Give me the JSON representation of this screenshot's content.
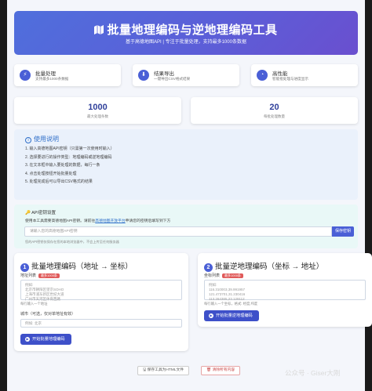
{
  "header": {
    "title": "批量地理编码与逆地理编码工具",
    "subtitle": "基于高德地图API | 专注于批量处理，支持最多1000条数据"
  },
  "features": [
    {
      "icon": "bolt-icon",
      "title": "批量处理",
      "desc": "支持最多1000条数据"
    },
    {
      "icon": "download-icon",
      "title": "结果导出",
      "desc": "一键导出CSV格式结果"
    },
    {
      "icon": "gauge-icon",
      "title": "高性能",
      "desc": "智能批处理与进度显示"
    }
  ],
  "stats": [
    {
      "value": "1000",
      "label": "最大处理条数"
    },
    {
      "value": "20",
      "label": "每批处理数量"
    }
  ],
  "usage": {
    "title": "使用说明",
    "steps": [
      "1. 输入高德地图API密钥（只需第一次使用时输入）",
      "2. 选择要进行的操作类型：地理编码或逆地理编码",
      "3. 在文本框中输入要处理的数据，每行一条",
      "4. 点击处理按钮开始批量处理",
      "5. 处理完成后可以导出CSV格式的结果"
    ]
  },
  "api": {
    "title": "API密钥设置",
    "desc_prefix": "使用本工具需要高德地图API密钥。请前往",
    "link": "高德地图开放平台",
    "desc_suffix": "申请您的密钥后填写到下方",
    "placeholder": "请输入您的高德地图API密钥",
    "save_label": "保存密钥",
    "note": "您的API密钥仅保存在您的本地浏览器中，不会上传至任何服务器"
  },
  "geocode": {
    "title": "批量地理编码（地址 → 坐标）",
    "list_label": "地址列表",
    "badge": "最多1000条",
    "placeholder": "例如:\n北京市朝阳区望京SOHO\n上海市浦东新区世纪大道\n广州市天河区体育西路",
    "hint": "每行输入一个地址",
    "city_label": "城市（可选，仅对单地址有效）",
    "city_placeholder": "例如: 北京",
    "run_label": "开始批量地理编码"
  },
  "regeocode": {
    "title": "批量逆地理编码（坐标 → 地址）",
    "list_label": "坐标列表",
    "badge": "最多1000条",
    "placeholder": "例如:\n116.310003,39.991957\n121.473701,31.230416\n113.264385,23.129112",
    "hint": "每行输入一个坐标，格式: 经度,纬度",
    "run_label": "开始批量逆地理编码"
  },
  "footer": {
    "save_label": "保存工具为HTML文件",
    "clear_label": "清除所有内容"
  },
  "watermark": "公众号 · Giser大刚"
}
